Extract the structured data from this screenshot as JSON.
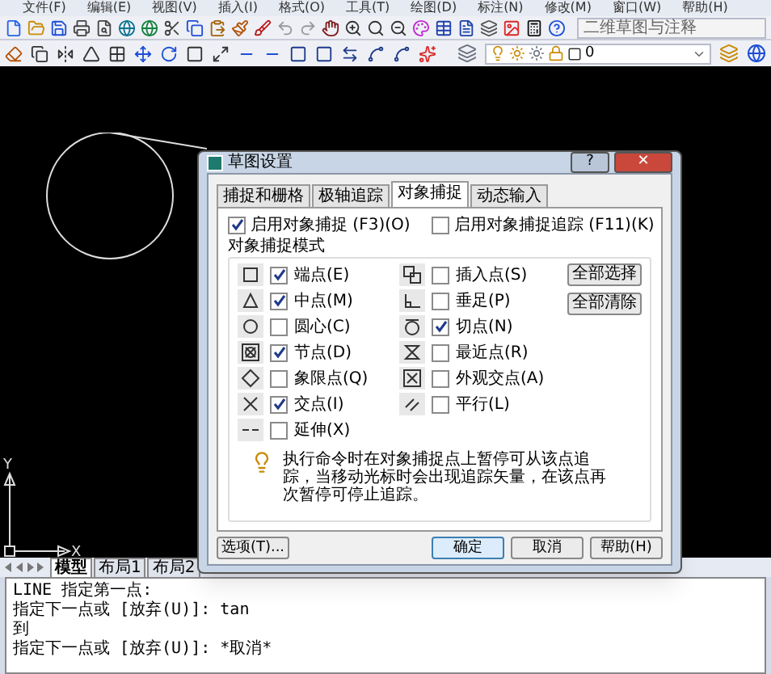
{
  "menu": [
    "文件(F)",
    "编辑(E)",
    "视图(V)",
    "插入(I)",
    "格式(O)",
    "工具(T)",
    "绘图(D)",
    "标注(N)",
    "修改(M)",
    "窗口(W)",
    "帮助(H)"
  ],
  "workspace": {
    "value": "二维草图与注释"
  },
  "layer": {
    "value": "0"
  },
  "canvas": {
    "axis_x": "X",
    "axis_y": "Y"
  },
  "layout_tabs": [
    {
      "label": "模型",
      "selected": true
    },
    {
      "label": "布局1",
      "selected": false
    },
    {
      "label": "布局2",
      "selected": false
    }
  ],
  "command_lines": [
    "LINE 指定第一点:",
    "指定下一点或 [放弃(U)]: tan",
    "到",
    "指定下一点或 [放弃(U)]: *取消*"
  ],
  "dialog": {
    "title": "草图设置",
    "title_buttons": [
      "?",
      "✕"
    ],
    "tabs": [
      {
        "label": "捕捉和栅格",
        "selected": false
      },
      {
        "label": "极轴追踪",
        "selected": false
      },
      {
        "label": "对象捕捉",
        "selected": true
      },
      {
        "label": "动态输入",
        "selected": false
      }
    ],
    "enable_osnap": {
      "label": "启用对象捕捉 (F3)(O)",
      "checked": true
    },
    "enable_tracking": {
      "label": "启用对象捕捉追踪 (F11)(K)",
      "checked": false
    },
    "group_title": "对象捕捉模式",
    "modes_left": [
      {
        "label": "端点(E)",
        "checked": true
      },
      {
        "label": "中点(M)",
        "checked": true
      },
      {
        "label": "圆心(C)",
        "checked": false
      },
      {
        "label": "节点(D)",
        "checked": true
      },
      {
        "label": "象限点(Q)",
        "checked": false
      },
      {
        "label": "交点(I)",
        "checked": true
      },
      {
        "label": "延伸(X)",
        "checked": false
      }
    ],
    "modes_right": [
      {
        "label": "插入点(S)",
        "checked": false
      },
      {
        "label": "垂足(P)",
        "checked": false
      },
      {
        "label": "切点(N)",
        "checked": true
      },
      {
        "label": "最近点(R)",
        "checked": false
      },
      {
        "label": "外观交点(A)",
        "checked": false
      },
      {
        "label": "平行(L)",
        "checked": false
      }
    ],
    "side_buttons": [
      "全部选择",
      "全部清除"
    ],
    "hint": "执行命令时在对象捕捉点上暂停可从该点追踪，当移动光标时会出现追踪矢量，在该点再次暂停可停止追踪。",
    "buttons": [
      {
        "label": "选项(T)...",
        "default": false
      },
      {
        "label": "确定",
        "default": true
      },
      {
        "label": "取消",
        "default": false
      },
      {
        "label": "帮助(H)",
        "default": false
      }
    ]
  }
}
